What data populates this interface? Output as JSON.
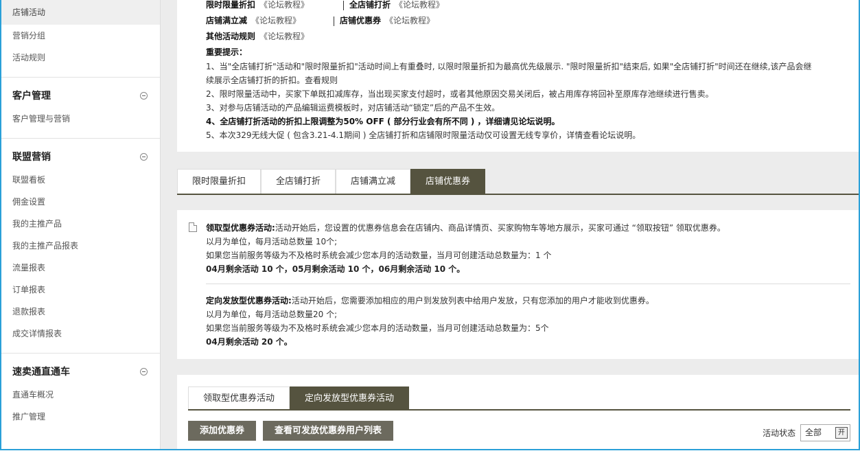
{
  "sidebar": {
    "top_items": [
      "店铺活动",
      "营销分组",
      "活动规则"
    ],
    "groups": [
      {
        "title": "客户管理",
        "items": [
          "客户管理与营销"
        ]
      },
      {
        "title": "联盟营销",
        "items": [
          "联盟看板",
          "佣金设置",
          "我的主推产品",
          "我的主推产品报表",
          "流量报表",
          "订单报表",
          "退款报表",
          "成交详情报表"
        ]
      },
      {
        "title": "速卖通直通车",
        "items": [
          "直通车概况",
          "推广管理"
        ]
      }
    ]
  },
  "rules": {
    "row1_left": "限时限量折扣",
    "row1_left_link": "《论坛教程》",
    "row1_right": "全店铺打折",
    "row1_right_link": "《论坛教程》",
    "row2_left": "店铺满立减",
    "row2_left_link": "《论坛教程》",
    "row2_right": "店铺优惠券",
    "row2_right_link": "《论坛教程》",
    "row3": "其他活动规则",
    "row3_link": "《论坛教程》",
    "notice_title": "重要提示：",
    "notice_1a": "1、当\"全店铺打折\"活动和\"限时限量折扣\"活动时间上有重叠时, 以限时限量折扣为最高优先级展示. \"限时限量折扣\"结束后, 如果\"全店铺打折\"时间还在继续,该产品会继",
    "notice_1b": "续展示全店铺打折的折扣。查看规则",
    "notice_2": "2、限时限量活动中，买家下单既扣减库存，当出现买家支付超时，或者其他原因交易关闭后，被占用库存将回补至原库存池继续进行售卖。",
    "notice_3": "3、对参与店铺活动的产品编辑运费模板时，对店铺活动“锁定”后的产品不生效。",
    "notice_4": "4、全店铺打折活动的折扣上限调整为50% OFF ( 部分行业会有所不同 ) ，详细请见论坛说明。",
    "notice_5": "5、本次329无线大促 ( 包含3.21-4.1期间 ) 全店铺打折和店铺限时限量活动仅可设置无线专享价，详情查看论坛说明。"
  },
  "main_tabs": [
    "限时限量折扣",
    "全店铺打折",
    "店铺满立减",
    "店铺优惠券"
  ],
  "info": {
    "b1_title": "领取型优惠券活动:",
    "b1_desc": "活动开始后，您设置的优惠券信息会在店铺内、商品详情页、买家购物车等地方展示，买家可通过 “领取按钮” 领取优惠券。",
    "b1_l2": "以月为单位，每月活动总数量 10个;",
    "b1_l3": "如果您当前服务等级为不及格时系统会减少您本月的活动数量，当月可创建活动总数量为：1 个",
    "b1_l4": "04月剩余活动 10 个，05月剩余活动 10 个，06月剩余活动 10 个。",
    "b2_title": "定向发放型优惠券活动:",
    "b2_desc": "活动开始后，您需要添加相应的用户到发放列表中给用户发放，只有您添加的用户才能收到优惠券。",
    "b2_l2": "以月为单位，每月活动总数量20 个;",
    "b2_l3": "如果您当前服务等级为不及格时系统会减少您本月的活动数量，当月可创建活动总数量为：5个",
    "b2_l4": "04月剩余活动 20 个。"
  },
  "sub_tabs": [
    "领取型优惠券活动",
    "定向发放型优惠券活动"
  ],
  "actions": {
    "add": "添加优惠券",
    "view": "查看可发放优惠券用户列表"
  },
  "status": {
    "label": "活动状态",
    "value": "全部",
    "arrow": "开"
  },
  "colors": {
    "accent": "#55533f",
    "frame": "#2aa0d8"
  }
}
